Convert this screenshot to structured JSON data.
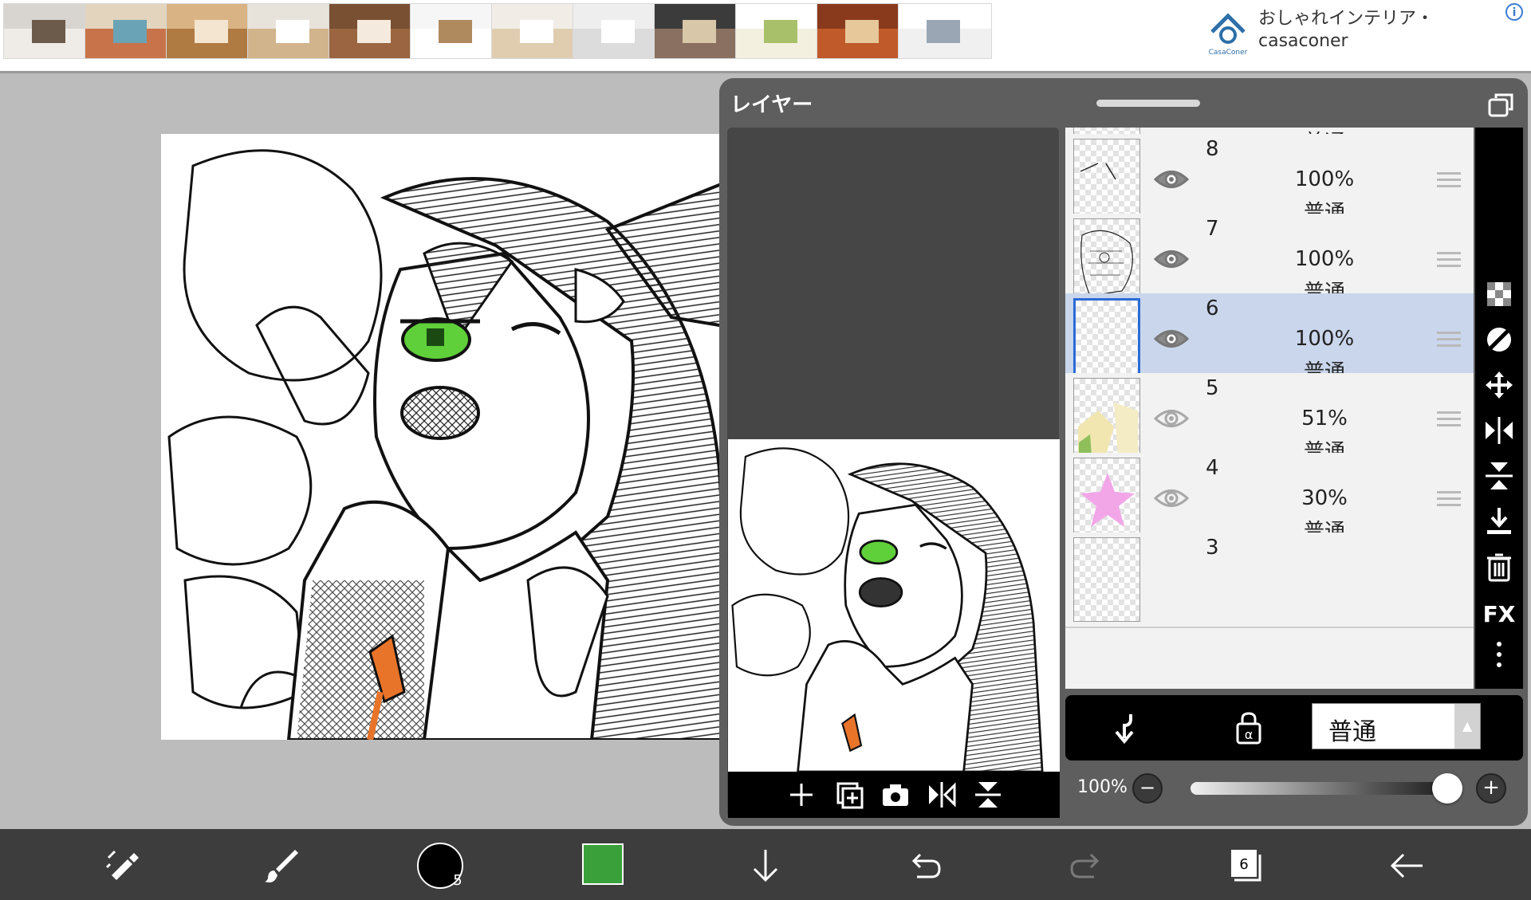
{
  "ad": {
    "title": "おしゃれインテリア・casaconer",
    "logo_text": "CasaConer",
    "info_icon": "i",
    "thumbnails": [
      {
        "name": "dining-set"
      },
      {
        "name": "colorful-rug"
      },
      {
        "name": "wood-interior"
      },
      {
        "name": "shelf-cabinet"
      },
      {
        "name": "wood-chest"
      },
      {
        "name": "tall-shelf-drawing"
      },
      {
        "name": "dining-room"
      },
      {
        "name": "white-living-room"
      },
      {
        "name": "dark-sofa"
      },
      {
        "name": "bookshelf-drawing"
      },
      {
        "name": "cabinet-room"
      },
      {
        "name": "storage-diagram"
      }
    ]
  },
  "panel": {
    "title": "レイヤー",
    "layers": [
      {
        "number": "",
        "opacity": "",
        "mode": "普通",
        "visible": true,
        "selected": false
      },
      {
        "number": "8",
        "opacity": "100%",
        "mode": "普通",
        "visible": true,
        "selected": false
      },
      {
        "number": "7",
        "opacity": "100%",
        "mode": "普通",
        "visible": true,
        "selected": false
      },
      {
        "number": "6",
        "opacity": "100%",
        "mode": "普通",
        "visible": true,
        "selected": true
      },
      {
        "number": "5",
        "opacity": "51%",
        "mode": "普通",
        "visible": false,
        "selected": false
      },
      {
        "number": "4",
        "opacity": "30%",
        "mode": "普通",
        "visible": false,
        "selected": false
      },
      {
        "number": "3",
        "opacity": "",
        "mode": "",
        "visible": false,
        "selected": false
      }
    ],
    "side_tools": [
      "transparency-lock-icon",
      "clip-icon",
      "move-icon",
      "flip-horizontal-icon",
      "flip-vertical-icon",
      "merge-down-icon",
      "trash-icon",
      "fx-icon",
      "more-icon"
    ],
    "fx_label": "FX",
    "blend_mode": "普通",
    "opacity_label": "100%",
    "opacity_value": 1.0,
    "minus_label": "−",
    "plus_label": "+"
  },
  "toolbar": {
    "brush_size": "5",
    "color": "#3aa03a",
    "layer_count": "6"
  },
  "colors": {
    "panel_bg": "#5e5e5e",
    "selected_row": "#c9d6ec",
    "accent": "#2a6bd6",
    "eye_green": "#5fcf3a",
    "zipper": "#e8742a"
  }
}
